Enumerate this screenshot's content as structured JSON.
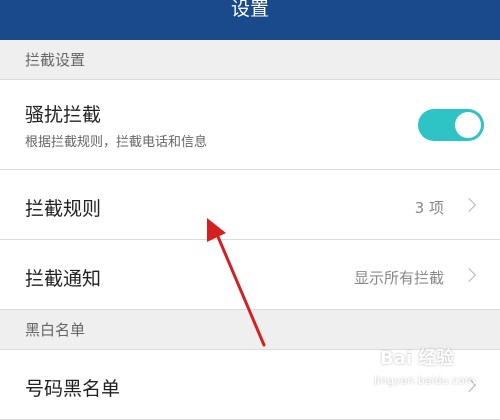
{
  "header": {
    "title": "设置"
  },
  "sections": {
    "intercept": {
      "label": "拦截设置"
    },
    "blackwhite": {
      "label": "黑白名单"
    }
  },
  "rows": {
    "harassment": {
      "label": "骚扰拦截",
      "sublabel": "根据拦截规则，拦截电话和信息",
      "toggle_on": true
    },
    "rules": {
      "label": "拦截规则",
      "value": "3 项"
    },
    "notice": {
      "label": "拦截通知",
      "value": "显示所有拦截"
    },
    "blacklist": {
      "label": "号码黑名单"
    }
  },
  "watermark": {
    "line1": "Bai 经验",
    "line2": "jingyan.baidu.com"
  },
  "colors": {
    "header_bg": "#1a4a8c",
    "toggle_on": "#2ec4c6",
    "annotation_arrow": "#d42020"
  }
}
